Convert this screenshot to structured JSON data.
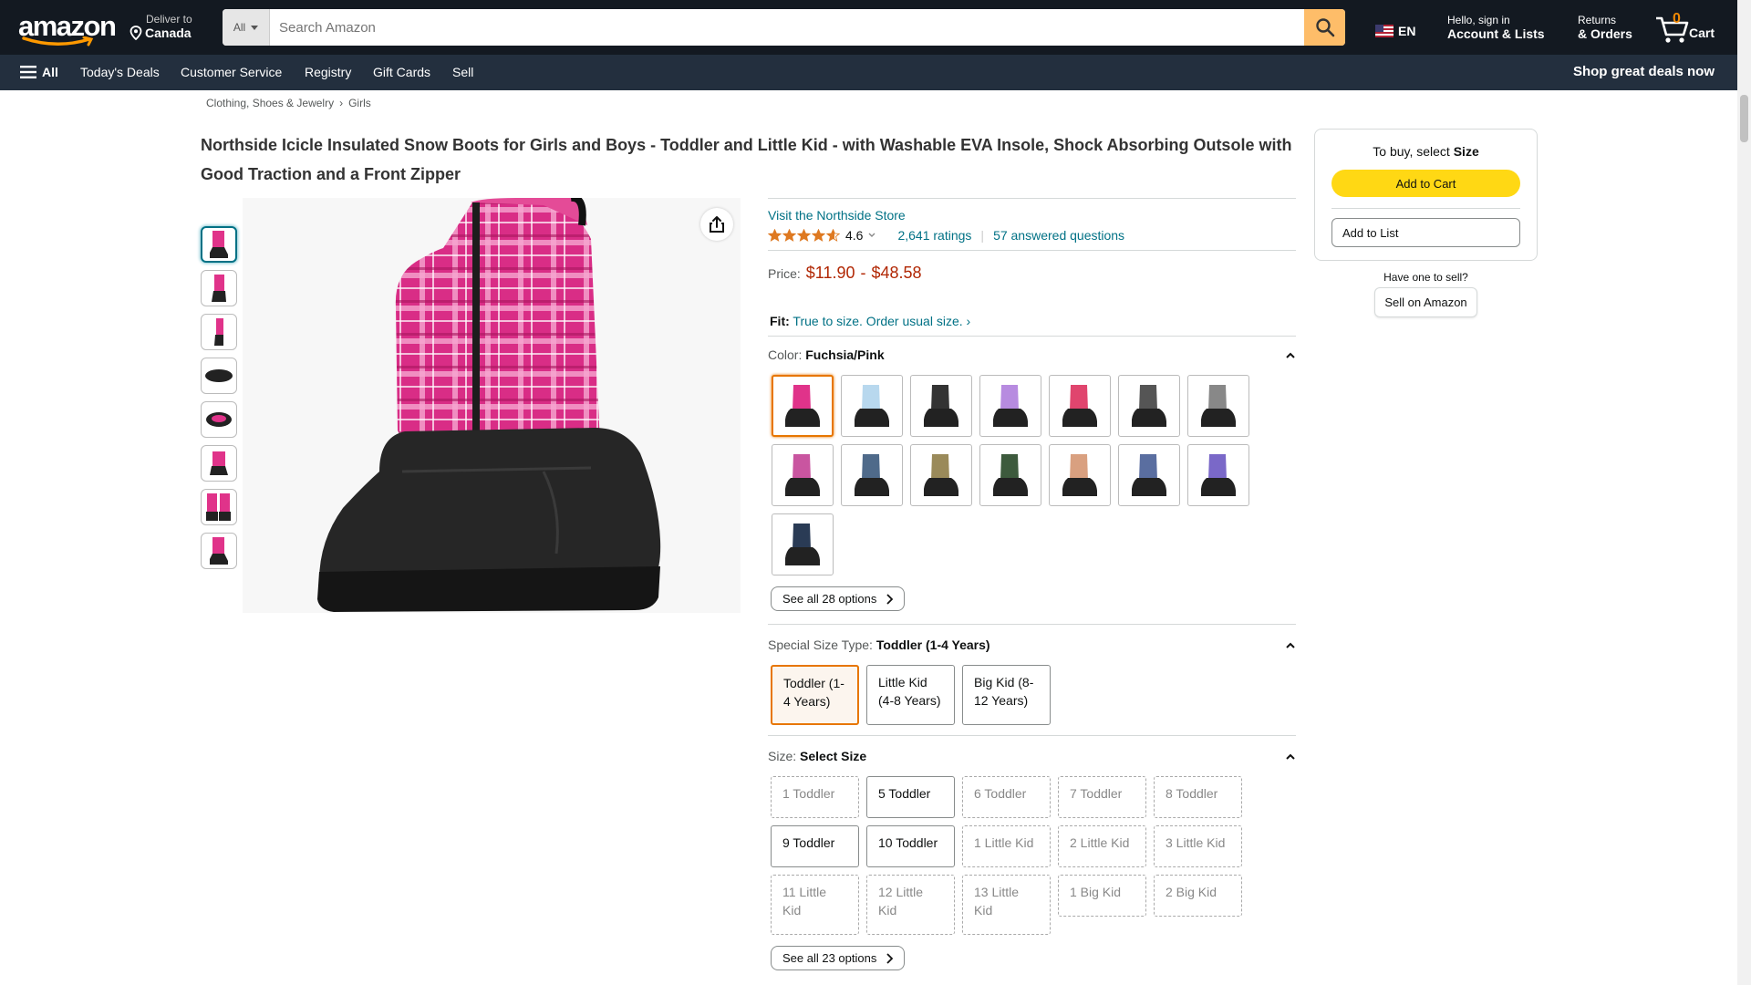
{
  "header": {
    "logo_text": "amazon",
    "deliver_small": "Deliver to",
    "deliver_location": "Canada",
    "search_category": "All",
    "search_placeholder": "Search Amazon",
    "language": "EN",
    "account_small": "Hello, sign in",
    "account_big": "Account & Lists",
    "returns_small": "Returns",
    "returns_big": "& Orders",
    "cart_count": "0",
    "cart_label": "Cart"
  },
  "subnav": {
    "all_label": "All",
    "links": [
      "Today's Deals",
      "Customer Service",
      "Registry",
      "Gift Cards",
      "Sell"
    ],
    "promo": "Shop great deals now"
  },
  "breadcrumb": [
    "Clothing, Shoes & Jewelry",
    "Girls"
  ],
  "product": {
    "title": "Northside Icicle Insulated Snow Boots for Girls and Boys - Toddler and Little Kid - with Washable EVA Insole, Shock Absorbing Outsole with Good Traction and a Front Zipper",
    "store_link": "Visit the Northside Store",
    "rating": "4.6",
    "rating_stars": 4.6,
    "ratings_count": "2,641 ratings",
    "answered": "57 answered questions",
    "price_label": "Price:",
    "price_low": "$11.90",
    "price_sep": "-",
    "price_high": "$48.58",
    "fit_label": "Fit:",
    "fit_value": "True to size. Order usual size.",
    "color_label": "Color:",
    "color_value": "Fuchsia/Pink",
    "see_all_colors": "See all 28 options",
    "size_type_label": "Special Size Type:",
    "size_type_value": "Toddler (1-4 Years)",
    "size_types": [
      "Toddler (1-4 Years)",
      "Little Kid (4-8 Years)",
      "Big Kid (8-12 Years)"
    ],
    "size_label": "Size:",
    "size_value": "Select Size",
    "sizes": [
      "1 Toddler",
      "5 Toddler",
      "6 Toddler",
      "7 Toddler",
      "8 Toddler",
      "9 Toddler",
      "10 Toddler",
      "1 Little Kid",
      "2 Little Kid",
      "3 Little Kid",
      "11 Little Kid",
      "12 Little Kid",
      "13 Little Kid",
      "1 Big Kid",
      "2 Big Kid"
    ],
    "see_all_sizes": "See all 23 options"
  },
  "buybox": {
    "prompt_prefix": "To buy, select",
    "prompt_bold": "Size",
    "add_to_cart": "Add to Cart",
    "add_to_list": "Add to List",
    "sell_question": "Have one to sell?",
    "sell_button": "Sell on Amazon"
  },
  "colors": {
    "accent": "#e77600",
    "link": "#007185",
    "price": "#b12704",
    "cart_button": "#ffd814",
    "nav_bg": "#131921",
    "subnav_bg": "#232f3e"
  },
  "icons": [
    "location-pin-icon",
    "search-icon",
    "us-flag-icon",
    "cart-icon",
    "hamburger-icon",
    "share-icon",
    "star-icon",
    "chevron-up-icon",
    "chevron-right-icon"
  ]
}
